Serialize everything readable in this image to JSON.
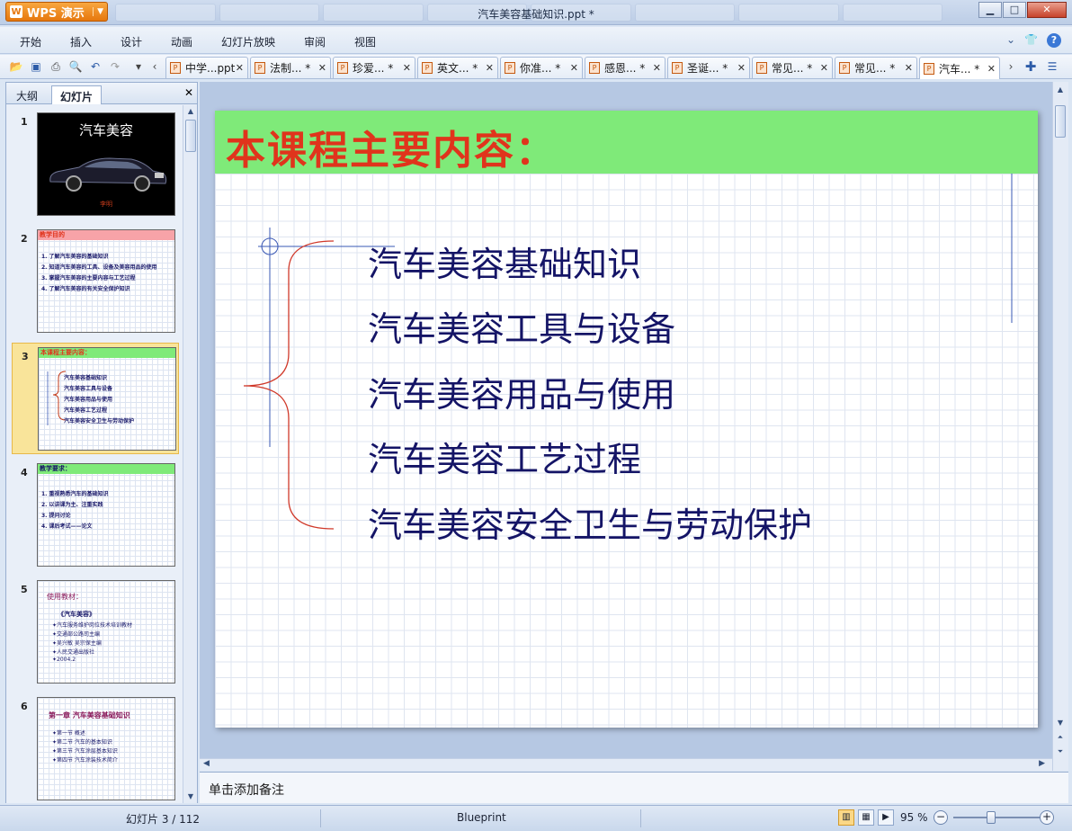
{
  "window": {
    "title": "汽车美容基础知识.ppt *",
    "app_button": "WPS 演示",
    "controls": [
      "minimize",
      "maximize",
      "close"
    ]
  },
  "menu": {
    "items": [
      "开始",
      "插入",
      "设计",
      "动画",
      "幻灯片放映",
      "审阅",
      "视图"
    ]
  },
  "toolbar": {
    "icons": [
      "open-icon",
      "save-icon",
      "print-icon",
      "print-preview-icon",
      "undo-icon",
      "redo-icon",
      "more-icon",
      "scroll-left-icon"
    ]
  },
  "doc_tabs": [
    {
      "label": "中学...ppt",
      "active": false
    },
    {
      "label": "法制... *",
      "active": false
    },
    {
      "label": "珍爱... *",
      "active": false
    },
    {
      "label": "英文... *",
      "active": false
    },
    {
      "label": "你准... *",
      "active": false
    },
    {
      "label": "感恩... *",
      "active": false
    },
    {
      "label": "圣诞... *",
      "active": false
    },
    {
      "label": "常见... *",
      "active": false
    },
    {
      "label": "常见... *",
      "active": false
    },
    {
      "label": "汽车... *",
      "active": true
    }
  ],
  "left_panel": {
    "tabs": [
      "大纲",
      "幻灯片"
    ],
    "active_tab": "幻灯片",
    "thumbnails": [
      {
        "num": "1",
        "title": "汽车美容",
        "author": "李明"
      },
      {
        "num": "2",
        "header": "教学目的",
        "lines": [
          "1. 了解汽车美容的基础知识",
          "2. 知道汽车美容的工具、设备及美容用品的使用",
          "3. 掌握汽车美容的主要内容与工艺过程",
          "4. 了解汽车美容的有关安全保护知识"
        ]
      },
      {
        "num": "3",
        "header": "本课程主要内容：",
        "lines": [
          "汽车美容基础知识",
          "汽车美容工具与设备",
          "汽车美容用品与使用",
          "汽车美容工艺过程",
          "汽车美容安全卫生与劳动保护"
        ]
      },
      {
        "num": "4",
        "header": "教学要求：",
        "lines": [
          "1. 重视熟悉汽车的基础知识",
          "2. 以讲课为主、注重实践",
          "3. 提问讨论",
          "4. 课后考试——论文"
        ]
      },
      {
        "num": "5",
        "header": "使用教材：",
        "lines": [
          "《汽车美容》",
          "✦汽车服务维护岗位技术培训教材",
          "✦交通部公路司主编",
          "✦吴兴敏 吴宗保主编",
          "✦人民交通出版社",
          "✦2004.2"
        ]
      },
      {
        "num": "6",
        "header": "第一章 汽车美容基础知识",
        "lines": [
          "✦第一节 概述",
          "✦第二节 汽车的基本知识",
          "✦第三节 汽车涂层基本知识",
          "✦第四节 汽车涂装技术简介"
        ]
      }
    ]
  },
  "slide": {
    "title": "本课程主要内容：",
    "bullets": [
      "汽车美容基础知识",
      "汽车美容工具与设备",
      "汽车美容用品与使用",
      "汽车美容工艺过程",
      "汽车美容安全卫生与劳动保护"
    ],
    "header_color": "#7fea79",
    "title_color": "#e0341c",
    "bullet_color": "#141466"
  },
  "notes": {
    "placeholder": "单击添加备注"
  },
  "status": {
    "slide_info": "幻灯片 3 / 112",
    "theme": "Blueprint",
    "zoom": "95 %",
    "zoom_percent": 95
  }
}
